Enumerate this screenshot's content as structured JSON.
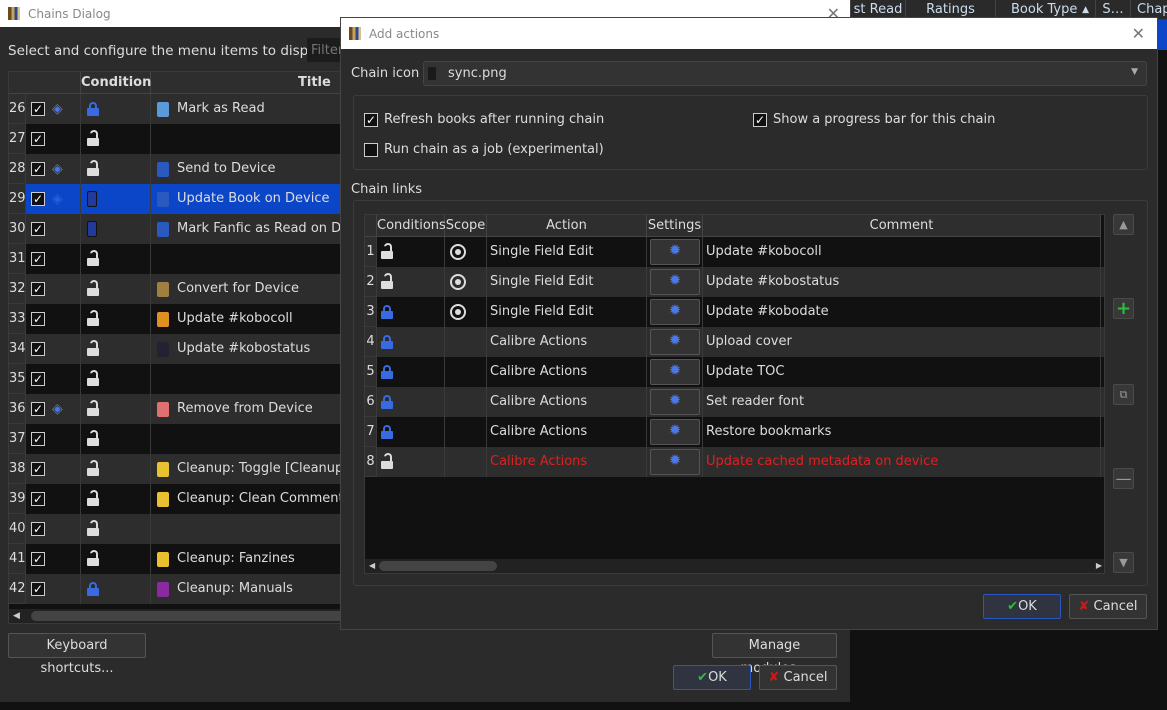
{
  "background_headers": [
    "st Read",
    "Ratings",
    "Book Type",
    "S…",
    "Chap"
  ],
  "chains_dialog": {
    "title": "Chains Dialog",
    "prompt": "Select and configure the menu items to display:",
    "filter_placeholder": "Filter",
    "columns": [
      "",
      "Conditions",
      "Title"
    ],
    "rows": [
      {
        "num": "26",
        "checked": true,
        "submenu": true,
        "lock": "closed",
        "icon": "book-mark-icon",
        "icon_color": "#5a9ad8",
        "title": "Mark as Read"
      },
      {
        "num": "27",
        "checked": true,
        "submenu": false,
        "lock": "open",
        "icon": "",
        "title": ""
      },
      {
        "num": "28",
        "checked": true,
        "submenu": true,
        "lock": "open",
        "icon": "device-upload-icon",
        "icon_color": "#2a5ac0",
        "title": "Send to Device"
      },
      {
        "num": "29",
        "checked": true,
        "submenu": true,
        "lock": "device",
        "icon": "device-upload-icon",
        "icon_color": "#2a5ac0",
        "title": "Update Book on Device",
        "selected": true
      },
      {
        "num": "30",
        "checked": true,
        "submenu": false,
        "lock": "device",
        "icon": "device-upload-icon",
        "icon_color": "#2a5ac0",
        "title": "Mark Fanfic as Read on Device"
      },
      {
        "num": "31",
        "checked": true,
        "submenu": false,
        "lock": "open",
        "icon": "",
        "title": ""
      },
      {
        "num": "32",
        "checked": true,
        "submenu": false,
        "lock": "open",
        "icon": "convert-icon",
        "icon_color": "#a08040",
        "title": "Convert for Device"
      },
      {
        "num": "33",
        "checked": true,
        "submenu": false,
        "lock": "open",
        "icon": "edit-field-icon",
        "icon_color": "#e09020",
        "title": "Update #kobocoll"
      },
      {
        "num": "34",
        "checked": true,
        "submenu": false,
        "lock": "open",
        "icon": "device-icon",
        "icon_color": "#223",
        "title": "Update #kobostatus"
      },
      {
        "num": "35",
        "checked": true,
        "submenu": false,
        "lock": "open",
        "icon": "",
        "title": ""
      },
      {
        "num": "36",
        "checked": true,
        "submenu": true,
        "lock": "open",
        "icon": "trash-icon",
        "icon_color": "#e07070",
        "title": "Remove from Device"
      },
      {
        "num": "37",
        "checked": true,
        "submenu": false,
        "lock": "open",
        "icon": "",
        "title": ""
      },
      {
        "num": "38",
        "checked": true,
        "submenu": false,
        "lock": "open",
        "icon": "broom-icon",
        "icon_color": "#e8c030",
        "title": "Cleanup: Toggle [Cleanup]"
      },
      {
        "num": "39",
        "checked": true,
        "submenu": false,
        "lock": "open",
        "icon": "broom-icon",
        "icon_color": "#e8c030",
        "title": "Cleanup: Clean Comments"
      },
      {
        "num": "40",
        "checked": true,
        "submenu": false,
        "lock": "open",
        "icon": "",
        "title": ""
      },
      {
        "num": "41",
        "checked": true,
        "submenu": false,
        "lock": "open",
        "icon": "broom-icon",
        "icon_color": "#e8c030",
        "title": "Cleanup: Fanzines"
      },
      {
        "num": "42",
        "checked": true,
        "submenu": false,
        "lock": "closed",
        "icon": "manual-book-icon",
        "icon_color": "#8a2aa0",
        "title": "Cleanup: Manuals"
      }
    ],
    "keyboard_shortcuts": "Keyboard shortcuts...",
    "manage_modules": "Manage modules...",
    "ok": "OK",
    "cancel": "Cancel"
  },
  "add_actions": {
    "title": "Add actions",
    "chain_icon_label": "Chain icon",
    "chain_icon_value": "sync.png",
    "options": [
      {
        "label": "Refresh books after running chain",
        "checked": true
      },
      {
        "label": "Show a progress bar for this chain",
        "checked": true
      },
      {
        "label": "Run chain as a job (experimental)",
        "checked": false
      }
    ],
    "chain_links_label": "Chain links",
    "columns": [
      "Conditions",
      "Scope",
      "Action",
      "Settings",
      "Comment"
    ],
    "links": [
      {
        "num": "1",
        "lock": "open",
        "scope": true,
        "action": "Single Field Edit",
        "comment": "Update #kobocoll",
        "error": false
      },
      {
        "num": "2",
        "lock": "open",
        "scope": true,
        "action": "Single Field Edit",
        "comment": "Update #kobostatus",
        "error": false
      },
      {
        "num": "3",
        "lock": "closed",
        "scope": true,
        "action": "Single Field Edit",
        "comment": "Update #kobodate",
        "error": false
      },
      {
        "num": "4",
        "lock": "closed",
        "scope": false,
        "action": "Calibre Actions",
        "comment": "Upload cover",
        "error": false
      },
      {
        "num": "5",
        "lock": "closed",
        "scope": false,
        "action": "Calibre Actions",
        "comment": "Update TOC",
        "error": false
      },
      {
        "num": "6",
        "lock": "closed",
        "scope": false,
        "action": "Calibre Actions",
        "comment": "Set reader font",
        "error": false
      },
      {
        "num": "7",
        "lock": "closed",
        "scope": false,
        "action": "Calibre Actions",
        "comment": "Restore bookmarks",
        "error": false
      },
      {
        "num": "8",
        "lock": "open",
        "scope": false,
        "action": "Calibre Actions",
        "comment": "Update cached metadata on device",
        "error": true
      }
    ],
    "error_color": "#e02020",
    "ok": "OK",
    "cancel": "Cancel"
  }
}
